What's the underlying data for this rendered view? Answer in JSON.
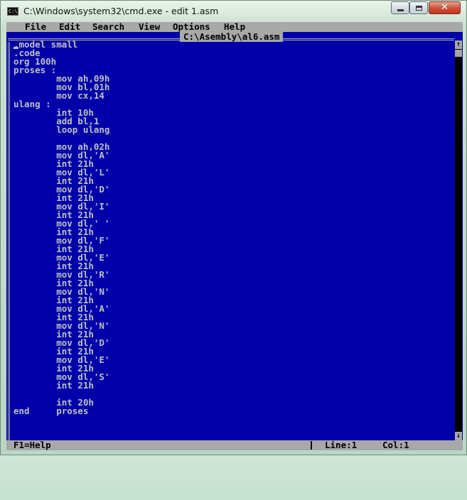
{
  "window": {
    "title": "C:\\Windows\\system32\\cmd.exe - edit  1.asm",
    "icon_text": "C:\\",
    "buttons": {
      "minimize": "minimize",
      "maximize": "maximize",
      "close": "✕"
    }
  },
  "menu": {
    "items": [
      "File",
      "Edit",
      "Search",
      "View",
      "Options",
      "Help"
    ]
  },
  "editor": {
    "file_title": "C:\\Asembly\\al6.asm",
    "lines": [
      ".model small",
      ".code",
      "org 100h",
      "proses :",
      "        mov ah,09h",
      "        mov bl,01h",
      "        mov cx,14",
      "ulang :",
      "        int 10h",
      "        add bl,1",
      "        loop ulang",
      "",
      "        mov ah,02h",
      "        mov dl,'A'",
      "        int 21h",
      "        mov dl,'L'",
      "        int 21h",
      "        mov dl,'D'",
      "        int 21h",
      "        mov dl,'I'",
      "        int 21h",
      "        mov dl,' '",
      "        int 21h",
      "        mov dl,'F'",
      "        int 21h",
      "        mov dl,'E'",
      "        int 21h",
      "        mov dl,'R'",
      "        int 21h",
      "        mov dl,'N'",
      "        int 21h",
      "        mov dl,'A'",
      "        int 21h",
      "        mov dl,'N'",
      "        int 21h",
      "        mov dl,'D'",
      "        int 21h",
      "        mov dl,'E'",
      "        int 21h",
      "        mov dl,'S'",
      "        int 21h",
      "",
      "        int 20h",
      "end     proses"
    ],
    "scroll": {
      "up": "↑",
      "down": "↓"
    }
  },
  "status": {
    "help": "F1=Help",
    "line": "Line:1",
    "col": "Col:1"
  },
  "colors": {
    "editor_bg": "#0000aa",
    "text": "#c0c0c0",
    "bars": "#a8a8a8"
  }
}
